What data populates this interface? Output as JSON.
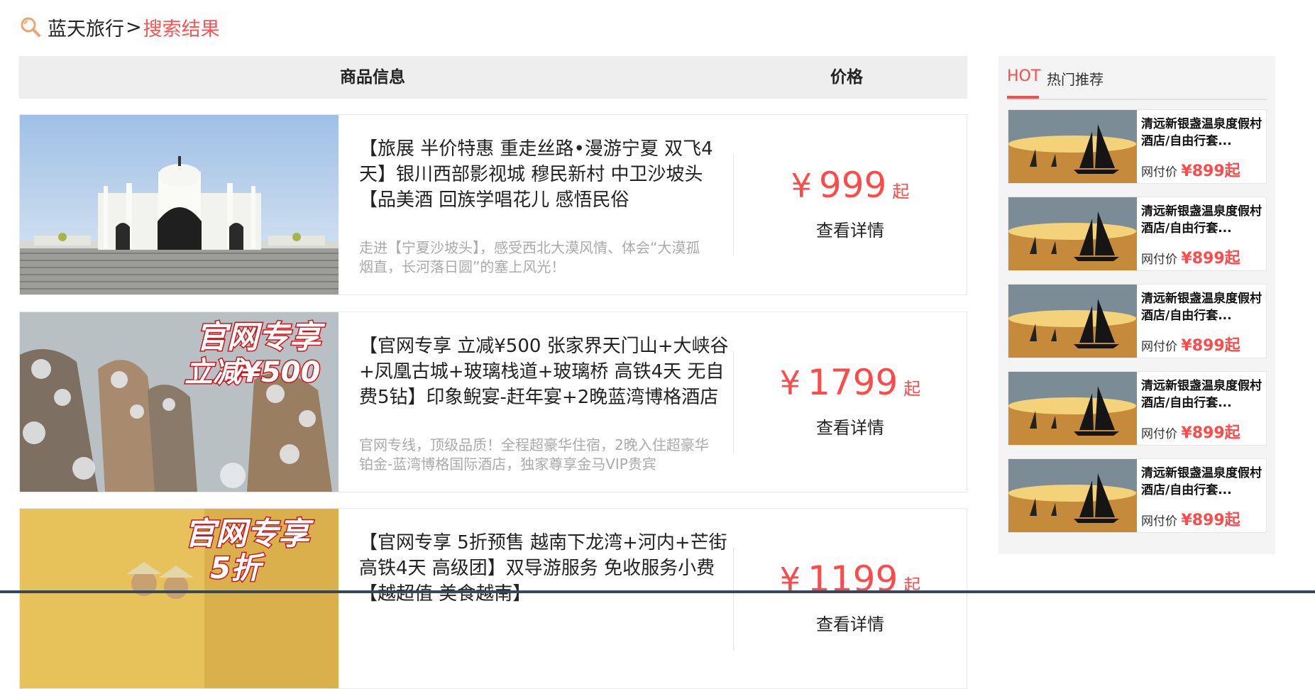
{
  "breadcrumb": {
    "root": "蓝天旅行",
    "separator": ">",
    "current": "搜索结果"
  },
  "table_header": {
    "info": "商品信息",
    "price": "价格"
  },
  "items": [
    {
      "title": "【旅展 半价特惠 重走丝路•漫游宁夏 双飞4天】银川西部影视城 穆民新村 中卫沙坡头【品美酒 回族学唱花儿 感悟民俗",
      "desc": "走进【宁夏沙坡头】，感受西北大漠风情、体会“大漠孤烟直，长河落日圆”的塞上风光！",
      "currency": "¥",
      "price": "999",
      "suffix": "起",
      "detail": "查看详情"
    },
    {
      "badge_line1": "官网专享",
      "badge_line2": "立减¥500",
      "title": "【官网专享 立减¥500 张家界天门山+大峡谷+凤凰古城+玻璃栈道+玻璃桥 高铁4天 无自费5钻】印象鲵宴-赶年宴+2晚蓝湾博格酒店",
      "desc": "官网专线，顶级品质！全程超豪华住宿，2晚入住超豪华铂金-蓝湾博格国际酒店，独家尊享金马VIP贵宾",
      "currency": "¥",
      "price": "1799",
      "suffix": "起",
      "detail": "查看详情"
    },
    {
      "badge_line1": "官网专享",
      "badge_line2": "5折",
      "title": "【官网专享 5折预售 越南下龙湾+河内+芒街 高铁4天 高级团】双导游服务 免收服务小费【越超值 美食越南】",
      "desc": "",
      "currency": "¥",
      "price": "1199",
      "suffix": "起",
      "detail": "查看详情"
    }
  ],
  "sidebar": {
    "tag": "HOT",
    "title": "热门推荐",
    "cards": [
      {
        "name": "清远新银盏温泉度假村酒店/自由行套...",
        "label": "网付价",
        "price": "¥899起"
      },
      {
        "name": "清远新银盏温泉度假村酒店/自由行套...",
        "label": "网付价",
        "price": "¥899起"
      },
      {
        "name": "清远新银盏温泉度假村酒店/自由行套...",
        "label": "网付价",
        "price": "¥899起"
      },
      {
        "name": "清远新银盏温泉度假村酒店/自由行套...",
        "label": "网付价",
        "price": "¥899起"
      },
      {
        "name": "清远新银盏温泉度假村酒店/自由行套...",
        "label": "网付价",
        "price": "¥899起"
      }
    ]
  },
  "colors": {
    "accent": "#ff4a4a",
    "header_bg": "#eeeeee",
    "sidebar_bg": "#f4f4f4"
  },
  "icons": {
    "breadcrumb": "search-icon"
  }
}
